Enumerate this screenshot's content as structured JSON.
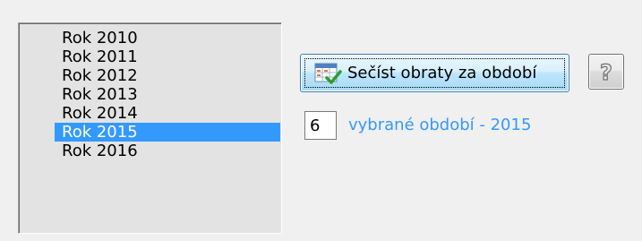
{
  "years": {
    "items": [
      "Rok 2010",
      "Rok 2011",
      "Rok 2012",
      "Rok 2013",
      "Rok 2014",
      "Rok 2015",
      "Rok 2016"
    ],
    "selected_index": 5
  },
  "sum_button": {
    "label": "Sečíst obraty za období",
    "icon": "calculator-check-icon"
  },
  "help_button": {
    "icon": "help-question-icon"
  },
  "period": {
    "value": "6",
    "label": "vybrané období - 2015"
  },
  "colors": {
    "selection": "#3399ff",
    "label_text": "#3399ff",
    "background": "#f0f0f0",
    "list_background": "#e3e3e3"
  }
}
